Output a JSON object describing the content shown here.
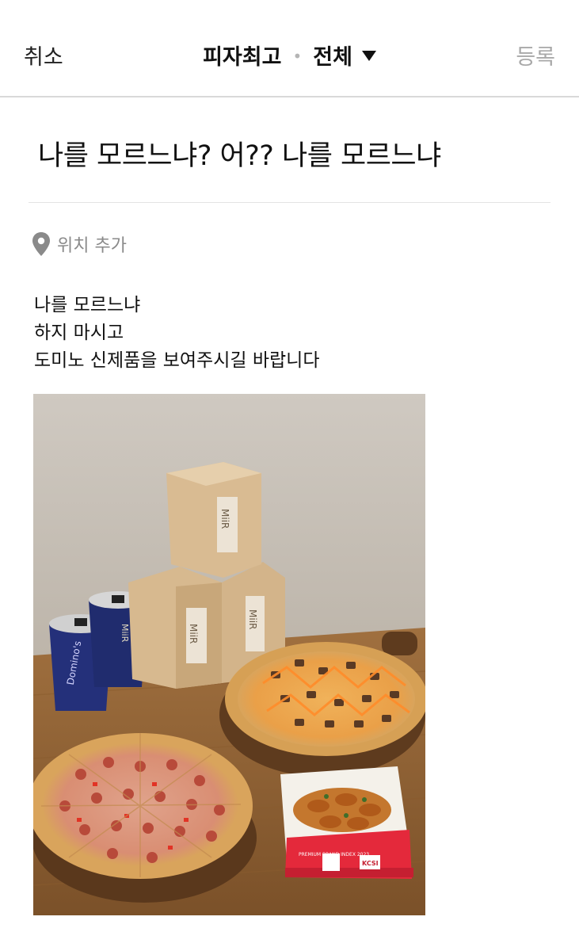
{
  "header": {
    "cancel_label": "취소",
    "board_name": "피자최고",
    "separator": "•",
    "filter_label": "전체",
    "submit_label": "등록"
  },
  "post": {
    "title": "나를 모르느냐? 어?? 나를 모르느냐",
    "location_label": "위치 추가",
    "body_lines": [
      "나를 모르느냐",
      "하지 마시고",
      "도미노 신제품을 보여주시길 바랍니다"
    ],
    "photo": {
      "cup_brand_text": "Domino's",
      "cup_logo_text": "MiiR",
      "box_logo_text": "MiiR",
      "pizza_box_badge_text": "PREMIUM BRAND INDEX 2023",
      "pizza_box_side_text": "KCSI"
    }
  },
  "colors": {
    "submit_disabled": "#a8a8a8",
    "location_icon": "#8a8a8a",
    "divider": "#e4e4e4"
  },
  "icons": {
    "caret": "triangle-down",
    "location": "map-pin"
  }
}
